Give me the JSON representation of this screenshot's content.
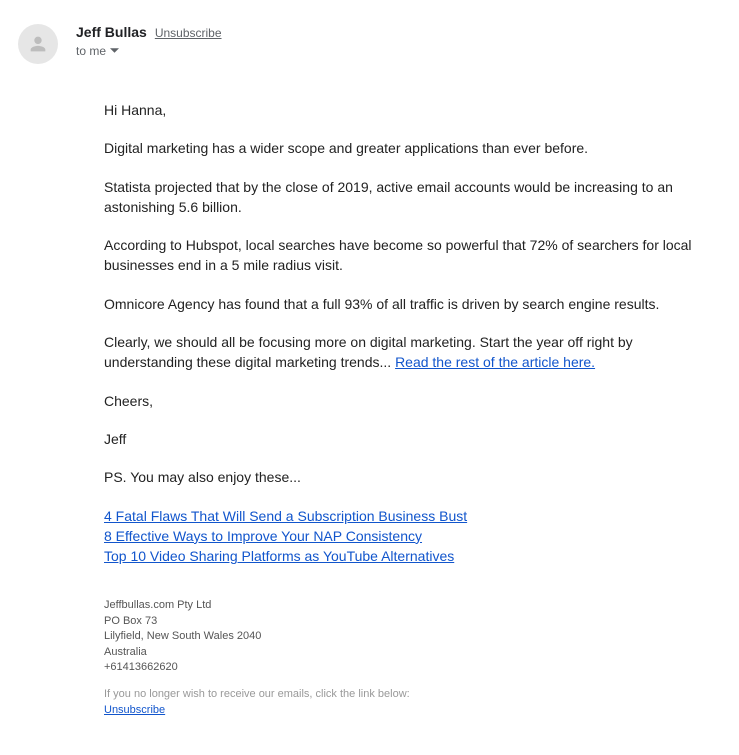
{
  "header": {
    "sender_name": "Jeff Bullas",
    "unsubscribe_label": "Unsubscribe",
    "recipient_label": "to me"
  },
  "body": {
    "greeting": "Hi Hanna,",
    "p1": "Digital marketing has a wider scope and greater applications than ever before.",
    "p2": "Statista projected that by the close of 2019, active email accounts would be increasing to an astonishing 5.6 billion.",
    "p3": "According to Hubspot, local searches have become so powerful that 72% of searchers for local businesses end in a 5 mile radius visit.",
    "p4": "Omnicore Agency has found that a full 93% of all traffic is driven by search engine results.",
    "p5_prefix": "Clearly, we should all be focusing more on digital marketing. Start the year off right by understanding these digital marketing trends... ",
    "p5_link": "Read the rest of the article here.",
    "signoff": "Cheers,",
    "signature": "Jeff",
    "ps_intro": "PS. You may also enjoy these...",
    "ps_links": {
      "l1": "4 Fatal Flaws That Will Send a Subscription Business Bust",
      "l2": "8 Effective Ways to Improve Your NAP Consistency",
      "l3": "Top 10 Video Sharing Platforms as YouTube Alternatives"
    }
  },
  "footer": {
    "company": "Jeffbullas.com Pty Ltd",
    "po_box": "PO Box 73",
    "city_line": "Lilyfield, New South Wales 2040",
    "country": "Australia",
    "phone": "+61413662620",
    "note": "If you no longer wish to receive our emails, click the link below:",
    "unsubscribe_label": "Unsubscribe"
  }
}
